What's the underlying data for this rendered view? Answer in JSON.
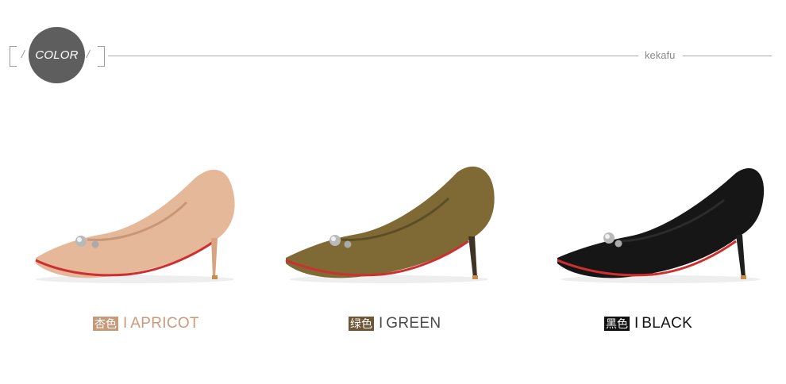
{
  "header": {
    "badge": "COLOR",
    "brand": "kekafu"
  },
  "colors": {
    "apricot": "#e6b89a",
    "apricot_text": "#c99a7a",
    "green": "#7f6a35",
    "green_tag": "#6f5635",
    "black": "#161616",
    "sole_red": "#cf2f2f",
    "heel_gold": "#c98d4a",
    "rule_grey": "#a9a9a9",
    "badge_grey": "#5e5e5e"
  },
  "variants": [
    {
      "tag": "杏色",
      "sep": "I",
      "name": "APRICOT"
    },
    {
      "tag": "绿色",
      "sep": "I",
      "name": "GREEN"
    },
    {
      "tag": "黑色",
      "sep": "I",
      "name": "BLACK"
    }
  ],
  "icons": {
    "brackets": "bracket-frame",
    "pearl": "pearl-ornament"
  }
}
